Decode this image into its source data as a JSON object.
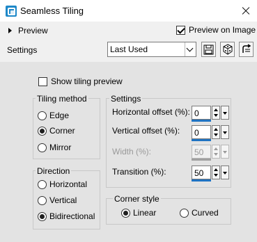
{
  "window": {
    "title": "Seamless Tiling"
  },
  "header": {
    "preview_label": "Preview",
    "preview_on_image_label": "Preview on Image",
    "preview_on_image_checked": true,
    "settings_label": "Settings",
    "preset_value": "Last Used"
  },
  "main": {
    "show_tiling_preview_label": "Show tiling preview",
    "show_tiling_preview_checked": false,
    "tiling_method": {
      "legend": "Tiling method",
      "options": [
        "Edge",
        "Corner",
        "Mirror"
      ],
      "selected": "Corner"
    },
    "direction": {
      "legend": "Direction",
      "options": [
        "Horizontal",
        "Vertical",
        "Bidirectional"
      ],
      "selected": "Bidirectional"
    },
    "settings_group": {
      "legend": "Settings",
      "horizontal_offset_label": "Horizontal offset (%):",
      "horizontal_offset_value": "0",
      "vertical_offset_label": "Vertical offset (%):",
      "vertical_offset_value": "0",
      "width_label": "Width (%):",
      "width_value": "50",
      "transition_label": "Transition (%):",
      "transition_value": "50"
    },
    "corner_style": {
      "legend": "Corner style",
      "options": [
        "Linear",
        "Curved"
      ],
      "selected": "Linear"
    }
  },
  "icons": {
    "app": "seamless-tiling-app-icon",
    "save": "save-preset-icon",
    "randomize": "randomize-dice-icon",
    "reset": "reset-icon"
  }
}
